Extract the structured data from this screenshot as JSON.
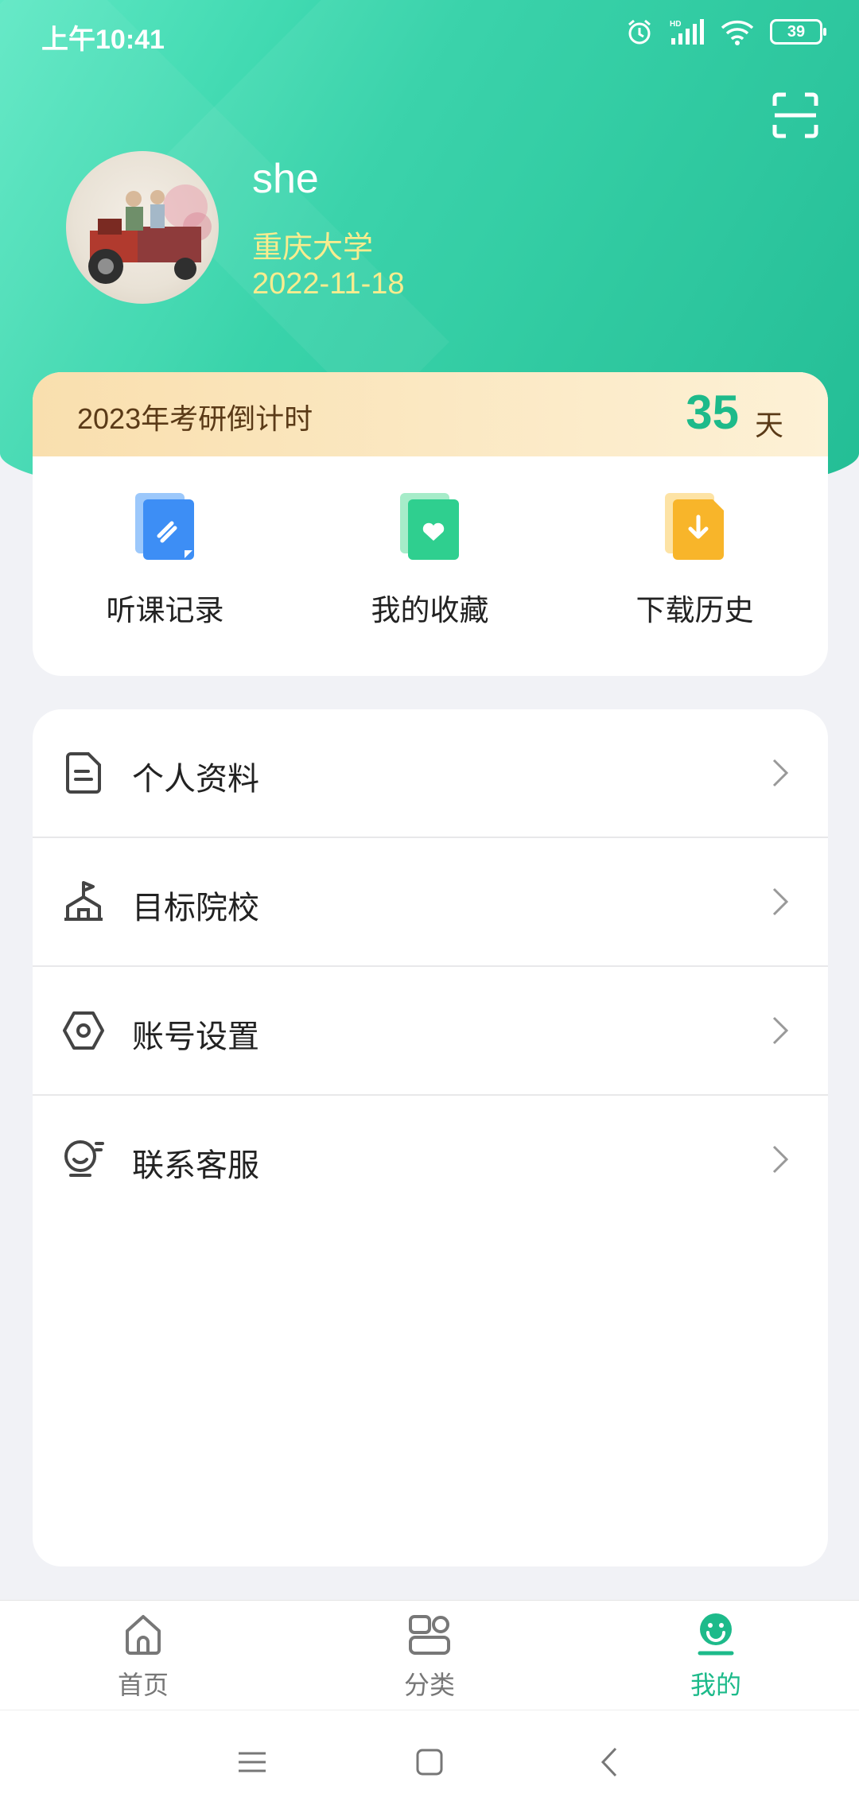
{
  "status_bar": {
    "time": "上午10:41",
    "battery": "39"
  },
  "profile": {
    "username": "she",
    "school": "重庆大学",
    "date": "2022-11-18"
  },
  "countdown": {
    "label": "2023年考研倒计时",
    "days": "35",
    "unit": "天"
  },
  "quick_actions": [
    {
      "label": "听课记录",
      "icon": "course-record-icon",
      "color": "#3d8ef5"
    },
    {
      "label": "我的收藏",
      "icon": "favorite-icon",
      "color": "#2fcf8f"
    },
    {
      "label": "下载历史",
      "icon": "download-history-icon",
      "color": "#f8b52a"
    }
  ],
  "menu": [
    {
      "label": "个人资料",
      "icon": "profile-doc-icon"
    },
    {
      "label": "目标院校",
      "icon": "school-building-icon"
    },
    {
      "label": "账号设置",
      "icon": "settings-hex-icon"
    },
    {
      "label": "联系客服",
      "icon": "customer-service-icon"
    }
  ],
  "tabs": [
    {
      "label": "首页",
      "icon": "home-icon"
    },
    {
      "label": "分类",
      "icon": "category-icon"
    },
    {
      "label": "我的",
      "icon": "mine-smile-icon",
      "active": true
    }
  ],
  "colors": {
    "accent": "#1dba8a",
    "hero_start": "#5fe8c4",
    "hero_end": "#16ba8f",
    "highlight": "#f8ec8e"
  }
}
